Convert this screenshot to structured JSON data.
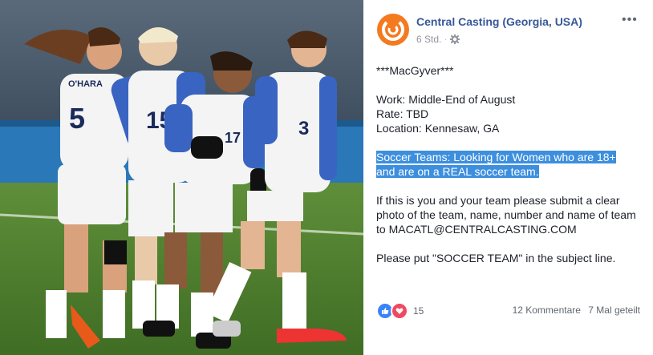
{
  "post": {
    "page_name": "Central Casting (Georgia, USA)",
    "time": "6 Std.",
    "lines": {
      "title": "***MacGyver***",
      "work": "Work: Middle-End of August",
      "rate": "Rate: TBD",
      "location": "Location: Kennesaw, GA",
      "highlight_line1": "Soccer Teams: Looking for Women who are 18+",
      "highlight_line2": "and are on a REAL soccer team.",
      "submit_line1": "If this is you and your team please submit a clear",
      "submit_line2": "photo of the team, name, number and name of team",
      "submit_line3": "to MACATL@CENTRALCASTING.COM",
      "subject": "Please put \"SOCCER TEAM\" in the subject line."
    },
    "reactions_count": "15",
    "comments": "12 Kommentare",
    "shares": "7 Mal geteilt"
  },
  "photo": {
    "jersey_numbers": [
      "5",
      "15",
      "17",
      "3"
    ],
    "player_name": "O'HARA"
  },
  "colors": {
    "link": "#365899",
    "highlight": "#3d8fde",
    "brand_orange": "#f47a20",
    "like": "#3b83f7",
    "love": "#f0495f"
  }
}
